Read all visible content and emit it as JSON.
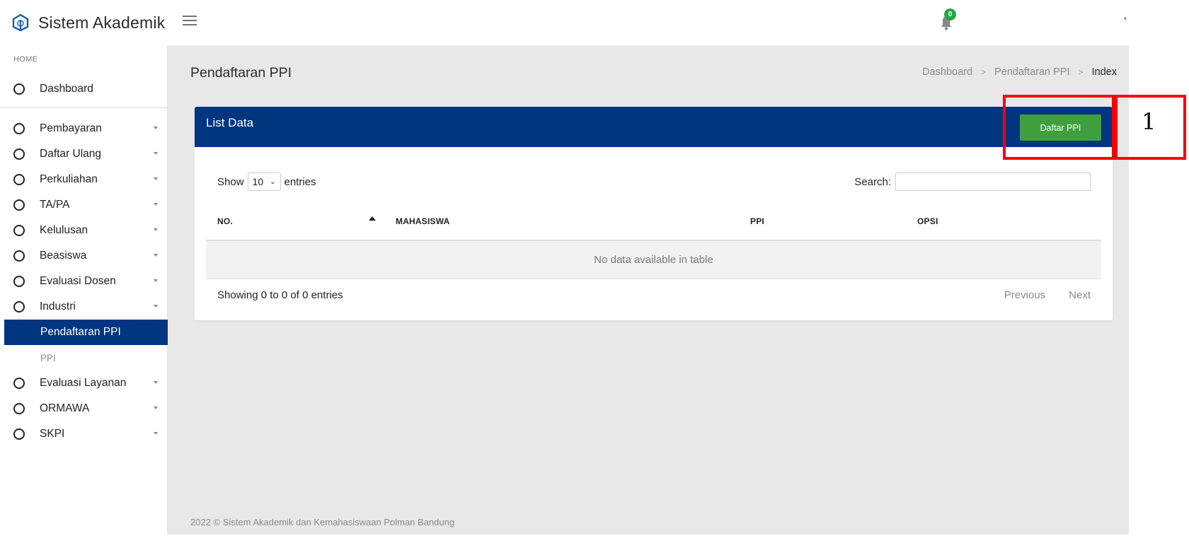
{
  "app": {
    "title": "Sistem Akademik",
    "notification_count": "0"
  },
  "sidebar": {
    "header": "HOME",
    "dashboard_label": "Dashboard",
    "items": [
      {
        "label": "Pembayaran",
        "icon": "circle-icon"
      },
      {
        "label": "Daftar Ulang",
        "icon": "circle-icon"
      },
      {
        "label": "Perkuliahan",
        "icon": "circle-icon"
      },
      {
        "label": "TA/PA",
        "icon": "circle-icon"
      },
      {
        "label": "Kelulusan",
        "icon": "circle-icon"
      },
      {
        "label": "Beasiswa",
        "icon": "circle-icon"
      },
      {
        "label": "Evaluasi Dosen",
        "icon": "circle-icon"
      },
      {
        "label": "Industri",
        "icon": "circle-icon"
      }
    ],
    "active_item": "Pendaftaran PPI",
    "sub_item": "PPI",
    "items_bottom": [
      {
        "label": "Evaluasi Layanan",
        "icon": "circle-icon"
      },
      {
        "label": "ORMAWA",
        "icon": "circle-icon"
      },
      {
        "label": "SKPI",
        "icon": "circle-icon"
      }
    ]
  },
  "page": {
    "title": "Pendaftaran PPI",
    "breadcrumb": [
      "Dashboard",
      "Pendaftaran PPI",
      "Index"
    ],
    "breadcrumb_separator": ">"
  },
  "card": {
    "title": "List Data",
    "button_label": "Daftar PPI",
    "show_label": "Show",
    "entries_value": "10",
    "entries_label": "entries",
    "search_label": "Search:",
    "search_value": "",
    "columns": [
      "NO.",
      "MAHASISWA",
      "PPI",
      "OPSI"
    ],
    "empty_message": "No data available in table",
    "info": "Showing 0 to 0 of 0 entries",
    "pager": {
      "previous": "Previous",
      "next": "Next"
    }
  },
  "footer": {
    "text": "2022 © Sistem Akademik dan Kemahasiswaan Polman Bandung"
  },
  "annotation": {
    "number": "1"
  },
  "colors": {
    "primary": "#003580",
    "button_green": "#3f9f3f",
    "annotation_red": "#ff0000"
  }
}
